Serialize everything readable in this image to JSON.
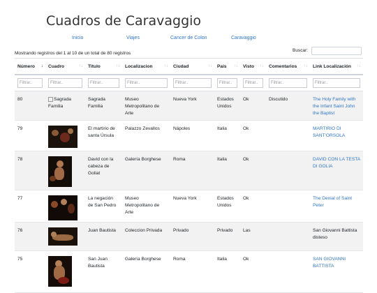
{
  "page": {
    "title": "Cuadros de Caravaggio"
  },
  "nav": [
    {
      "label": "Inicio"
    },
    {
      "label": "Viajes"
    },
    {
      "label": "Cancer de Colon"
    },
    {
      "label": "Caravaggio"
    }
  ],
  "table_info": "Mostrando registros del 1 al 10 de un total de 80 registros",
  "search": {
    "label": "Buscar:",
    "value": ""
  },
  "columns": [
    "Número",
    "Cuadro",
    "Titulo",
    "Localizacion",
    "Ciudad",
    "Pais",
    "Visto",
    "Comentarios",
    "Link Localización"
  ],
  "filter_placeholder": "Filtrar..",
  "rows": [
    {
      "numero": "80",
      "cuadro_alt": "Sagrada Familia",
      "titulo": "Sagrada Familia",
      "localizacion": "Museo Metropolitano de Arte",
      "ciudad": "Nueva York",
      "pais": "Estados Unidos",
      "visto": "Ok",
      "comentarios": "Discutido",
      "link": "The Holy Family with the Infant Saint John the Baptist"
    },
    {
      "numero": "79",
      "cuadro_alt": "",
      "titulo": "El martirio de santa Úrsula",
      "localizacion": "Palazzo Zevallos",
      "ciudad": "Nápoles",
      "pais": "Italia",
      "visto": "Ok",
      "comentarios": "",
      "link": "MARTIRIO DI SANT'ORSOLA"
    },
    {
      "numero": "78",
      "cuadro_alt": "",
      "titulo": "David con la cabeza de Goliat",
      "localizacion": "Galería Borghese",
      "ciudad": "Roma",
      "pais": "Italia",
      "visto": "Ok",
      "comentarios": "",
      "link": "DAVID CON LA TESTA DI GOLIA"
    },
    {
      "numero": "77",
      "cuadro_alt": "",
      "titulo": "La negación de San Pedro",
      "localizacion": "Museo Metropolitano de Arte",
      "ciudad": "Nueva York",
      "pais": "Estados Unidos",
      "visto": "Ok",
      "comentarios": "",
      "link": "The Denial of Saint Peter"
    },
    {
      "numero": "76",
      "cuadro_alt": "",
      "titulo": "Juan Bautista",
      "localizacion": "Coleccion Privada",
      "ciudad": "Privado",
      "pais": "Privado",
      "visto": "Las",
      "comentarios": "",
      "link": "San Giovanni Battista disteso"
    },
    {
      "numero": "75",
      "cuadro_alt": "",
      "titulo": "San Juan Bautista",
      "localizacion": "Galería Borghese",
      "ciudad": "Roma",
      "pais": "Italia",
      "visto": "Ok",
      "comentarios": "",
      "link": "SAN GIOVANNI BATTISTA"
    }
  ]
}
